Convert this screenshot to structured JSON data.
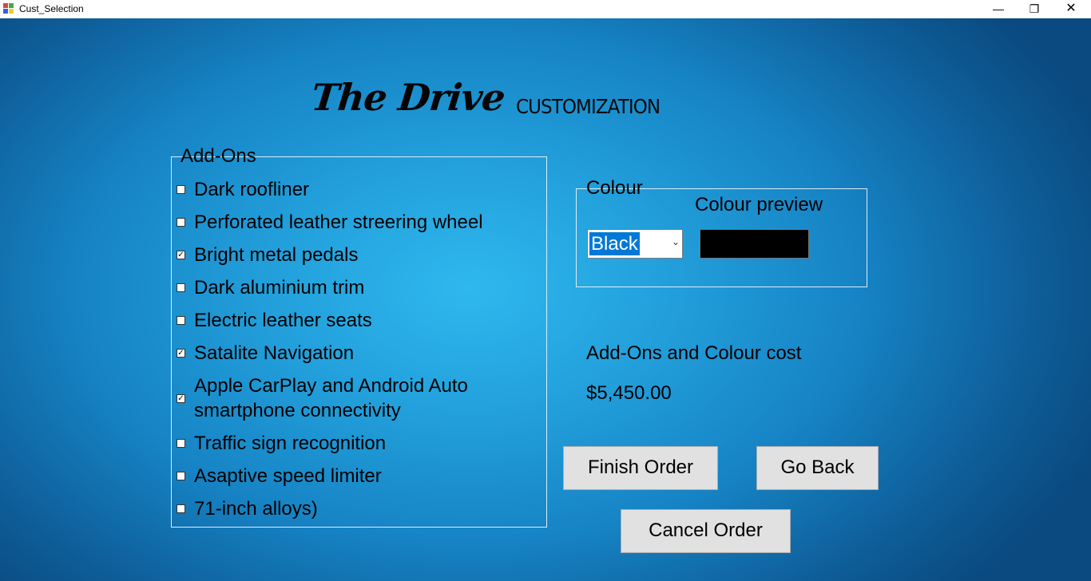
{
  "window": {
    "title": "Cust_Selection",
    "minimize_icon": "minimize-icon",
    "maximize_icon": "restore-icon",
    "close_icon": "close-icon"
  },
  "header": {
    "logo": "The Drive",
    "subtitle": "CUSTOMIZATION"
  },
  "addons": {
    "legend": "Add-Ons",
    "items": [
      {
        "label": "Dark roofliner",
        "checked": false
      },
      {
        "label": "Perforated leather streering wheel",
        "checked": false
      },
      {
        "label": "Bright metal pedals",
        "checked": true
      },
      {
        "label": "Dark aluminium trim",
        "checked": false
      },
      {
        "label": "Electric leather seats",
        "checked": false
      },
      {
        "label": "Satalite Navigation",
        "checked": true
      },
      {
        "label": "Apple CarPlay and Android Auto smartphone connectivity",
        "checked": true
      },
      {
        "label": "Traffic sign recognition",
        "checked": false
      },
      {
        "label": "Asaptive speed limiter",
        "checked": false
      },
      {
        "label": "71-inch alloys)",
        "checked": false
      }
    ]
  },
  "colour": {
    "legend": "Colour",
    "preview_label": "Colour preview",
    "selected": "Black",
    "preview_color": "#000000"
  },
  "cost": {
    "label": "Add-Ons and Colour cost",
    "value": "$5,450.00"
  },
  "buttons": {
    "finish": "Finish Order",
    "back": "Go Back",
    "cancel": "Cancel Order"
  },
  "colors": {
    "background_center": "#2fb8ee",
    "background_edge": "#0a4a80",
    "button_face": "#e1e1e1",
    "selection_highlight": "#0078d7"
  }
}
